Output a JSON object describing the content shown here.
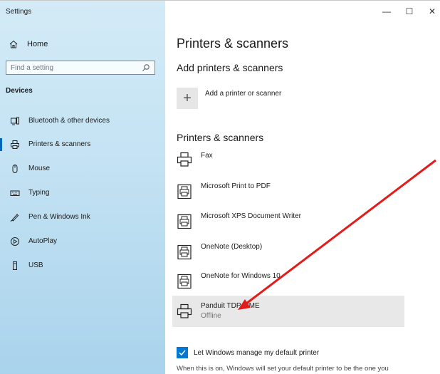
{
  "window": {
    "title": "Settings",
    "controls": {
      "minimize": "—",
      "maximize": "☐",
      "close": "✕"
    }
  },
  "sidebar": {
    "home_label": "Home",
    "search_placeholder": "Find a setting",
    "section_title": "Devices",
    "items": [
      {
        "label": "Bluetooth & other devices",
        "icon": "bluetooth-devices-icon"
      },
      {
        "label": "Printers & scanners",
        "icon": "printer-icon",
        "selected": true
      },
      {
        "label": "Mouse",
        "icon": "mouse-icon"
      },
      {
        "label": "Typing",
        "icon": "keyboard-icon"
      },
      {
        "label": "Pen & Windows Ink",
        "icon": "pen-icon"
      },
      {
        "label": "AutoPlay",
        "icon": "autoplay-icon"
      },
      {
        "label": "USB",
        "icon": "usb-icon"
      }
    ]
  },
  "main": {
    "page_title": "Printers & scanners",
    "add_section_title": "Add printers & scanners",
    "add_button_label": "Add a printer or scanner",
    "add_button_icon": "+",
    "list_title": "Printers & scanners",
    "printers": [
      {
        "name": "Fax",
        "status": "",
        "icon": "printer-icon"
      },
      {
        "name": "Microsoft Print to PDF",
        "status": "",
        "icon": "document-printer-icon"
      },
      {
        "name": "Microsoft XPS Document Writer",
        "status": "",
        "icon": "document-printer-icon"
      },
      {
        "name": "OneNote (Desktop)",
        "status": "",
        "icon": "document-printer-icon"
      },
      {
        "name": "OneNote for Windows 10",
        "status": "",
        "icon": "document-printer-icon"
      },
      {
        "name": "Panduit TDP43ME",
        "status": "Offline",
        "icon": "printer-icon",
        "highlighted": true
      }
    ],
    "default_checkbox_label": "Let Windows manage my default printer",
    "default_checkbox_checked": true,
    "default_description": "When this is on, Windows will set your default printer to be the one you"
  },
  "colors": {
    "accent": "#0078d7",
    "annotation_arrow": "#e21b1b",
    "sidebar_top": "#d3ebf7",
    "sidebar_bottom": "#a9d3ec",
    "highlight_row": "#e8e8e8"
  }
}
